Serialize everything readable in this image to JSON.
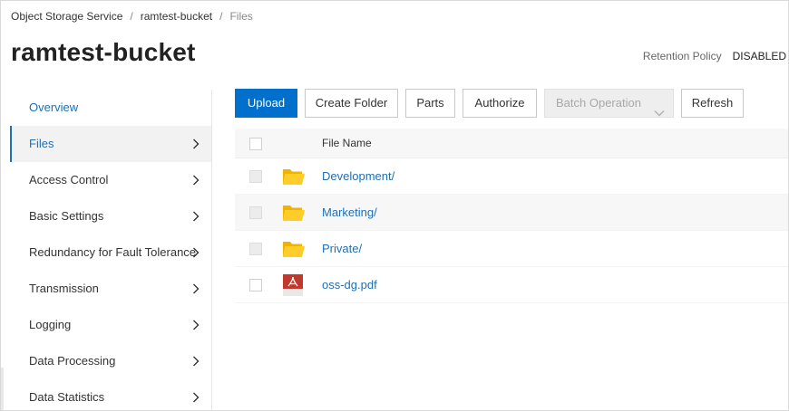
{
  "breadcrumb": {
    "items": [
      "Object Storage Service",
      "ramtest-bucket",
      "Files"
    ],
    "separator": "/"
  },
  "header": {
    "title": "ramtest-bucket",
    "retention_label": "Retention Policy",
    "retention_value": "DISABLED"
  },
  "sidebar": {
    "items": [
      {
        "label": "Overview",
        "has_chevron": false
      },
      {
        "label": "Files",
        "has_chevron": true,
        "active": true
      },
      {
        "label": "Access Control",
        "has_chevron": true
      },
      {
        "label": "Basic Settings",
        "has_chevron": true
      },
      {
        "label": "Redundancy for Fault Tolerance",
        "has_chevron": true
      },
      {
        "label": "Transmission",
        "has_chevron": true
      },
      {
        "label": "Logging",
        "has_chevron": true
      },
      {
        "label": "Data Processing",
        "has_chevron": true
      },
      {
        "label": "Data Statistics",
        "has_chevron": true
      }
    ]
  },
  "toolbar": {
    "upload": "Upload",
    "create_folder": "Create Folder",
    "parts": "Parts",
    "authorize": "Authorize",
    "batch_operation": "Batch Operation",
    "refresh": "Refresh"
  },
  "table": {
    "column_file_name": "File Name",
    "rows": [
      {
        "name": "Development/",
        "icon": "folder-icon"
      },
      {
        "name": "Marketing/",
        "icon": "folder-icon"
      },
      {
        "name": "Private/",
        "icon": "folder-icon"
      },
      {
        "name": "oss-dg.pdf",
        "icon": "pdf-file-icon"
      }
    ]
  },
  "colors": {
    "primary": "#0070cc",
    "link": "#1f6fb5",
    "folder": "#f5c518",
    "pdf": "#c0392b"
  }
}
